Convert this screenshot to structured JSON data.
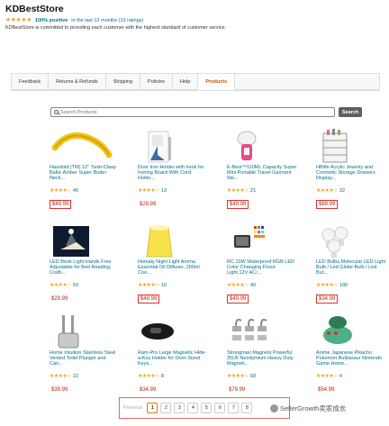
{
  "header": {
    "store_name": "KDBestStore",
    "stars": "★★★★★",
    "positive": "100% positive",
    "rating_rest": "in the last 12 months (10 ratings)",
    "tagline": "KDBestStore is committed to providing each customer with the highest standard of customer service."
  },
  "tabs": [
    {
      "label": "Feedback"
    },
    {
      "label": "Returns & Refunds"
    },
    {
      "label": "Shipping"
    },
    {
      "label": "Policies"
    },
    {
      "label": "Help"
    },
    {
      "label": "Products"
    }
  ],
  "search": {
    "placeholder": "Search Products",
    "button": "Search"
  },
  "products": [
    {
      "title": "Hazeloid (TM) 12\" Twist-Clasp Baltic Amber Super Butter Neck...",
      "stars": "★★★★☆",
      "count": "46",
      "price": "$49.99",
      "boxed": true,
      "icon": "amber-necklace-icon"
    },
    {
      "title": "Door Iron Holder with hook for Ironing Board With Cord Holde...",
      "stars": "★★★★☆",
      "count": "13",
      "price": "$29.99",
      "boxed": false,
      "icon": "iron-holder-icon"
    },
    {
      "title": "E-Best™110ML Capacity Super Mini Portable Travel Garment Ste...",
      "stars": "★★★★☆",
      "count": "21",
      "price": "$49.99",
      "boxed": true,
      "icon": "garment-steamer-icon"
    },
    {
      "title": "HBlife Acrylic Jewelry and Cosmetic Storage Drawers Display...",
      "stars": "★★★★☆",
      "count": "32",
      "price": "$89.99",
      "boxed": true,
      "icon": "cosmetic-drawers-icon"
    },
    {
      "title": "LED Book Light Hands Free Adjustable for Bed Reading, Crafti...",
      "stars": "★★★★☆",
      "count": "59",
      "price": "$29.99",
      "boxed": false,
      "icon": "book-light-icon"
    },
    {
      "title": "Homaly Night Light Aroma Essential Oil Diffuser, 200ml Coo...",
      "stars": "★★★★☆",
      "count": "16",
      "price": "$49.99",
      "boxed": true,
      "icon": "oil-diffuser-icon"
    },
    {
      "title": "RC 10W Waterproof RGB LED Color Changing Flood Light,12V AC/...",
      "stars": "★★★★☆",
      "count": "40",
      "price": "$49.99",
      "boxed": true,
      "icon": "flood-light-icon"
    },
    {
      "title": "LED Bulbs,Molecular LED Light Bulb / Led Globe Bulb / Led But...",
      "stars": "★★★★☆",
      "count": "180",
      "price": "$34.99",
      "boxed": true,
      "icon": "led-bulbs-icon"
    },
    {
      "title": "Home Intuition Stainless Steel Vented Toilet Plunger and Can...",
      "stars": "★★★★☆",
      "count": "22",
      "price": "$39.99",
      "boxed": false,
      "icon": "toilet-plunger-icon"
    },
    {
      "title": "Ram-Pro Large Magnetic Hide-a-Key Holder for Over-Sized Keys...",
      "stars": "★★★★☆",
      "count": "8",
      "price": "$34.99",
      "boxed": false,
      "icon": "key-holder-icon"
    },
    {
      "title": "Strongman Magnets Powerful 25LB Neodymium Heavy Duty Magneti...",
      "stars": "★★★★☆",
      "count": "68",
      "price": "$79.99",
      "boxed": false,
      "icon": "magnet-hooks-icon"
    },
    {
      "title": "Anime Japanese Pikachu Pokemon Bulbasaur Nintendo Game Home...",
      "stars": "★★★★☆",
      "count": "4",
      "price": "$54.99",
      "boxed": false,
      "icon": "bulbasaur-planter-icon"
    }
  ],
  "pagination": {
    "previous": "Previous",
    "pages": [
      "1",
      "2",
      "3",
      "4",
      "5",
      "6",
      "7",
      "8"
    ],
    "current": "1"
  },
  "watermark": "SellerGrowth卖家成长"
}
